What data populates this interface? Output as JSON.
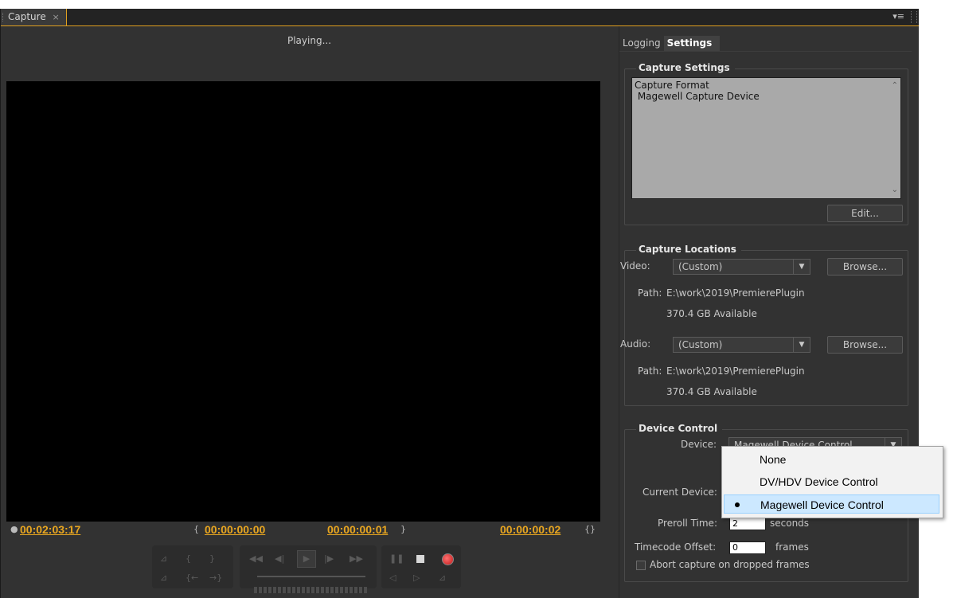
{
  "window": {
    "tab_title": "Capture",
    "tab_close": "×",
    "menu_icon": "▾≡"
  },
  "preview": {
    "status": "Playing..."
  },
  "timecodes": {
    "current": "00:02:03:17",
    "in_point": "00:00:00:00",
    "out_point": "00:00:00:01",
    "duration": "00:00:00:02"
  },
  "tabs": {
    "logging": "Logging",
    "settings": "Settings"
  },
  "capture_settings": {
    "title": "Capture Settings",
    "line1": "Capture Format",
    "line2": " Magewell Capture Device",
    "edit_button": "Edit..."
  },
  "capture_locations": {
    "title": "Capture Locations",
    "video_label": "Video:",
    "video_value": "(Custom)",
    "video_browse": "Browse...",
    "video_path_label": "Path:",
    "video_path": "E:\\work\\2019\\PremierePlugin",
    "video_available": "370.4 GB Available",
    "audio_label": "Audio:",
    "audio_value": "(Custom)",
    "audio_browse": "Browse...",
    "audio_path_label": "Path:",
    "audio_path": "E:\\work\\2019\\PremierePlugin",
    "audio_available": "370.4 GB Available"
  },
  "device_control": {
    "title": "Device Control",
    "device_label": "Device:",
    "device_value": "Magewell Device Control",
    "current_device_label": "Current Device:",
    "preroll_label": "Preroll Time:",
    "preroll_value": "2",
    "preroll_unit": "seconds",
    "timecode_offset_label": "Timecode Offset:",
    "timecode_offset_value": "0",
    "timecode_offset_unit": "frames",
    "abort_label": "Abort capture on dropped frames",
    "abort_checked": false
  },
  "device_dropdown": {
    "options": [
      "None",
      "DV/HDV Device Control",
      "Magewell Device Control"
    ],
    "selected": "Magewell Device Control"
  },
  "colors": {
    "timecode": "#e8a620",
    "panel_bg": "#323232",
    "accent_border": "#e0a020",
    "selection": "#cce8ff"
  }
}
